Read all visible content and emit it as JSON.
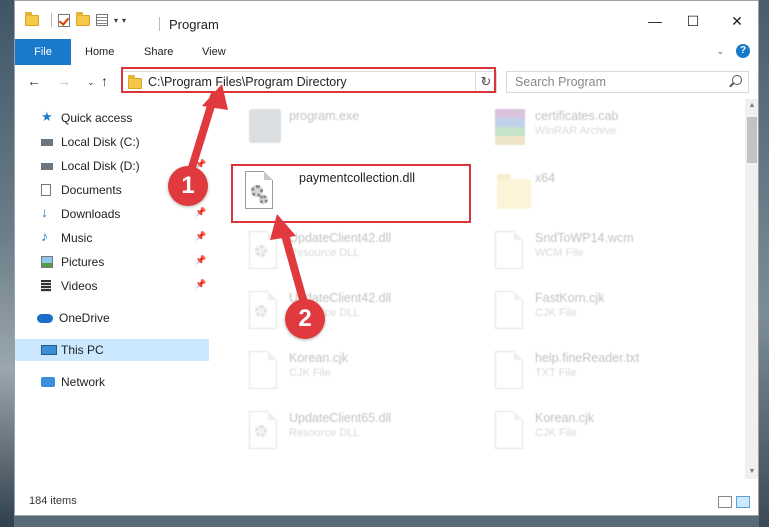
{
  "window": {
    "title": "Program"
  },
  "ribbon": {
    "tabs": [
      "File",
      "Home",
      "Share",
      "View"
    ]
  },
  "address": {
    "path": "C:\\Program Files\\Program Directory"
  },
  "search": {
    "placeholder": "Search Program"
  },
  "sidebar": {
    "items": [
      {
        "label": "Quick access",
        "icon": "star-icon",
        "pinned": false
      },
      {
        "label": "Local Disk (C:)",
        "icon": "drive-icon",
        "pinned": true
      },
      {
        "label": "Local Disk (D:)",
        "icon": "drive-icon",
        "pinned": true
      },
      {
        "label": "Documents",
        "icon": "documents-icon",
        "pinned": true
      },
      {
        "label": "Downloads",
        "icon": "download-icon",
        "pinned": true
      },
      {
        "label": "Music",
        "icon": "music-icon",
        "pinned": true
      },
      {
        "label": "Pictures",
        "icon": "pictures-icon",
        "pinned": true
      },
      {
        "label": "Videos",
        "icon": "videos-icon",
        "pinned": true
      },
      {
        "label": "OneDrive",
        "icon": "cloud-icon",
        "pinned": false
      },
      {
        "label": "This PC",
        "icon": "computer-icon",
        "pinned": false,
        "selected": true
      },
      {
        "label": "Network",
        "icon": "network-icon",
        "pinned": false
      }
    ]
  },
  "files": [
    {
      "name": "program.exe",
      "type": "",
      "icon": "exe-icon"
    },
    {
      "name": "certificates.cab",
      "type": "WinRAR Archive",
      "icon": "archive-icon"
    },
    {
      "name": "paymentcollection.dll",
      "type": "",
      "icon": "dll-icon",
      "highlighted": true
    },
    {
      "name": "x64",
      "type": "",
      "icon": "folder-icon"
    },
    {
      "name": "UpdateClient42.dll",
      "type": "Resource DLL",
      "icon": "dll-icon"
    },
    {
      "name": "SndToWP14.wcm",
      "type": "WCM File",
      "icon": "file-icon"
    },
    {
      "name": "UpdateClient42.dll",
      "type": "Resource DLL",
      "icon": "dll-icon"
    },
    {
      "name": "FastKorn.cjk",
      "type": "CJK File",
      "icon": "file-icon"
    },
    {
      "name": "Korean.cjk",
      "type": "CJK File",
      "icon": "file-icon"
    },
    {
      "name": "help.fineReader.txt",
      "type": "TXT File",
      "icon": "file-icon"
    },
    {
      "name": "UpdateClient65.dll",
      "type": "Resource DLL",
      "icon": "dll-icon"
    },
    {
      "name": "Korean.cjk",
      "type": "CJK File",
      "icon": "file-icon"
    }
  ],
  "status": {
    "items": "184 items"
  },
  "annotations": {
    "badge1": "1",
    "badge2": "2"
  },
  "colors": {
    "accent": "#1979ca",
    "highlight": "#d9353b",
    "selected": "#cce8ff"
  }
}
